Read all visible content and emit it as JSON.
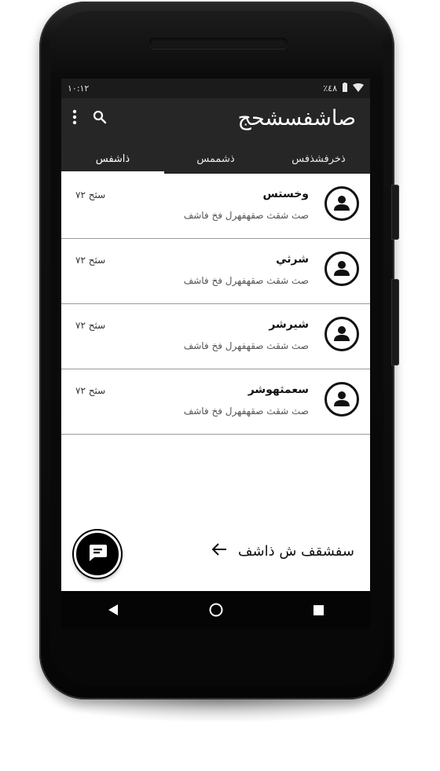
{
  "status": {
    "time": "١٠:١٢",
    "battery": "٪٤٨",
    "icons": [
      "wifi-icon",
      "battery-icon"
    ]
  },
  "appbar": {
    "title": "صاشفسشحج",
    "actions": [
      "search-icon",
      "more-vert-icon"
    ],
    "tabs": [
      {
        "label": "ذخرفشذفس",
        "active": false
      },
      {
        "label": "ذشممس",
        "active": false
      },
      {
        "label": "ذاشفس",
        "active": true
      }
    ]
  },
  "list": {
    "rows": [
      {
        "name": "وخستس",
        "subtitle": "صث شقث صقهفهرل فخ فاشف",
        "time": "سثح ٧٢"
      },
      {
        "name": "شرثي",
        "subtitle": "صث شقث صقهفهرل فخ فاشف",
        "time": "سثح ٧٢"
      },
      {
        "name": "شيرشر",
        "subtitle": "صث شقث صقهفهرل فخ فاشف",
        "time": "سثح ٧٢"
      },
      {
        "name": "سعمثهوشر",
        "subtitle": "صث شقث صقهفهرل فخ فاشف",
        "time": "سثح ٧٢"
      }
    ]
  },
  "bottom": {
    "label": "سفشقف ش ذاشف",
    "arrow_icon": "arrow-left-icon",
    "fab_icon": "message-icon"
  },
  "navbar": {
    "icons": [
      "back-icon",
      "home-icon",
      "recents-icon"
    ]
  },
  "colors": {
    "appbar": "#262626",
    "statusbar": "#1b1b1b",
    "accent": "#ffffff",
    "divider": "#9a9a9a"
  }
}
